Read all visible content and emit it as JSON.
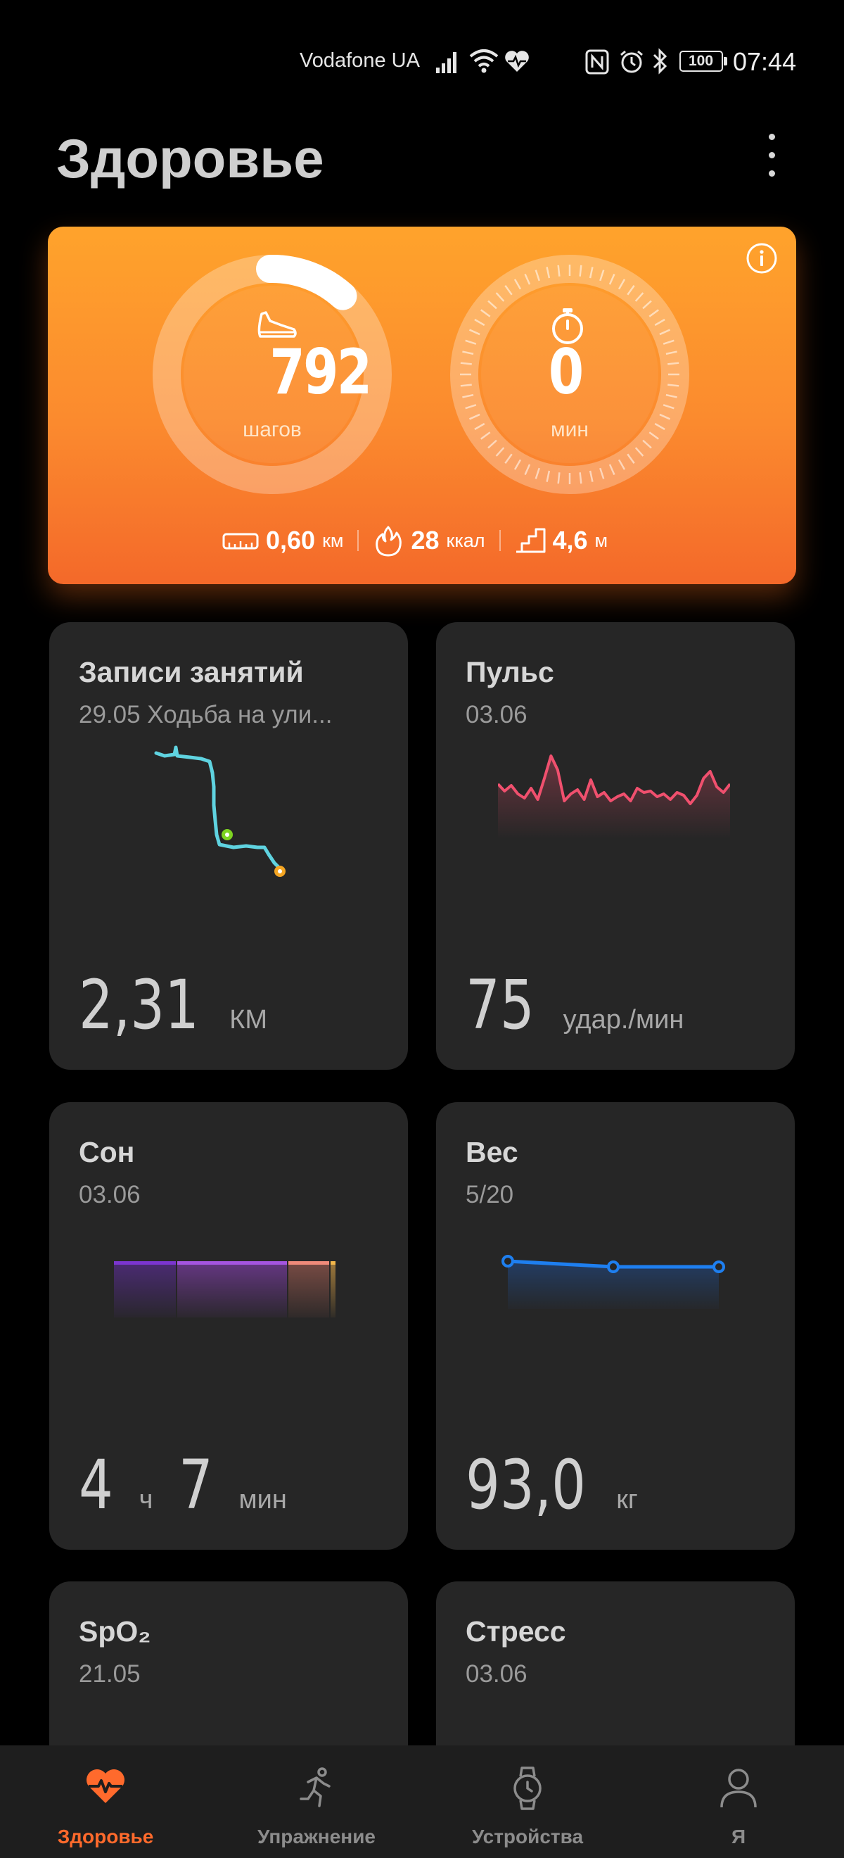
{
  "status_bar": {
    "carrier": "Vodafone UA",
    "battery": "100",
    "time": "07:44"
  },
  "header": {
    "title": "Здоровье"
  },
  "activity": {
    "steps": "792",
    "steps_unit": "шагов",
    "steps_goal_progress": 0.12,
    "minutes": "0",
    "minutes_unit": "мин",
    "distance_value": "0,60",
    "distance_unit": "км",
    "calories_value": "28",
    "calories_unit": "ккал",
    "climb_value": "4,6",
    "climb_unit": "м"
  },
  "cards": {
    "workouts": {
      "title": "Записи занятий",
      "subtitle": "29.05 Ходьба на ули...",
      "value": "2,31",
      "unit": "КМ"
    },
    "pulse": {
      "title": "Пульс",
      "subtitle": "03.06",
      "value": "75",
      "unit": "удар./мин"
    },
    "sleep": {
      "title": "Сон",
      "subtitle": "03.06",
      "hours": "4",
      "hours_unit": "ч",
      "minutes": "7",
      "minutes_unit": "мин"
    },
    "weight": {
      "title": "Вес",
      "subtitle": "5/20",
      "value": "93,0",
      "unit": "кг"
    },
    "spo2": {
      "title": "SpO₂",
      "subtitle": "21.05"
    },
    "stress": {
      "title": "Стресс",
      "subtitle": "03.06"
    }
  },
  "bottom_nav": {
    "items": [
      {
        "label": "Здоровье",
        "icon": "heart-pulse-icon",
        "active": true
      },
      {
        "label": "Упражнение",
        "icon": "runner-icon",
        "active": false
      },
      {
        "label": "Устройства",
        "icon": "watch-icon",
        "active": false
      },
      {
        "label": "Я",
        "icon": "person-icon",
        "active": false
      }
    ]
  },
  "colors": {
    "accent": "#ff6a2c",
    "hero_top": "#ffa32c",
    "hero_bottom": "#f4692a",
    "pulse_line": "#f0506e",
    "route_line": "#5fd3e0",
    "weight_line": "#1e7ff0"
  }
}
